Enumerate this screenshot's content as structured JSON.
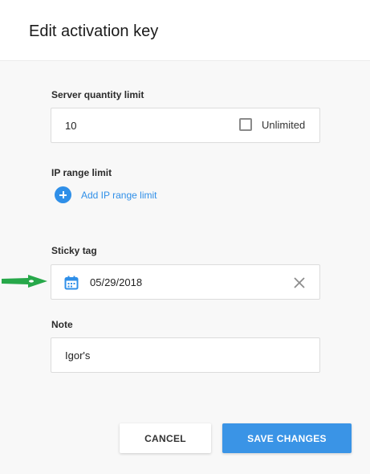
{
  "dialog": {
    "title": "Edit activation key"
  },
  "server_quantity": {
    "label": "Server quantity limit",
    "value": "10",
    "unlimited_label": "Unlimited",
    "unlimited_checked": false
  },
  "ip_range": {
    "label": "IP range limit",
    "add_label": "Add IP range limit"
  },
  "sticky_tag": {
    "label": "Sticky tag",
    "date_value": "05/29/2018"
  },
  "note": {
    "label": "Note",
    "value": "Igor's"
  },
  "actions": {
    "cancel_label": "CANCEL",
    "save_label": "SAVE CHANGES"
  },
  "icons": {
    "add": "plus-circle-icon",
    "date": "calendar-icon",
    "clear": "close-icon",
    "annotation": "arrow-right-icon"
  },
  "colors": {
    "accent": "#2f8fe8",
    "save_button": "#3a94e6",
    "annotation_arrow": "#27a84a"
  }
}
